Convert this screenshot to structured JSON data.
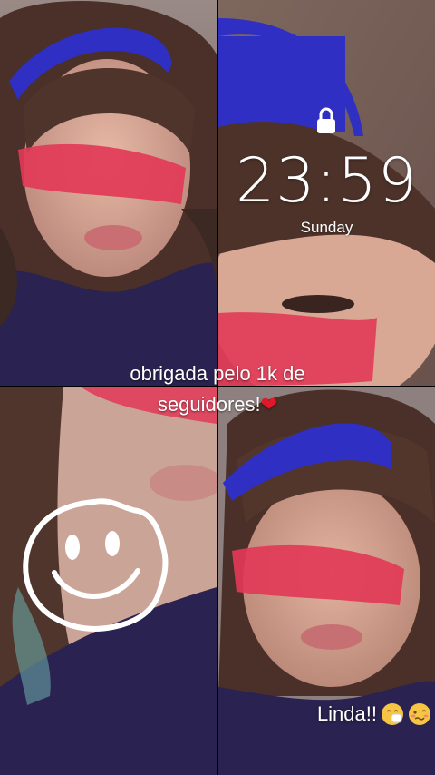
{
  "lockscreen": {
    "time": "23:59",
    "day": "Sunday",
    "lock_icon": "lock-icon"
  },
  "caption": {
    "line1": "obrigada pelo 1k de",
    "line2": "seguidores!",
    "heart": "❤"
  },
  "comment": {
    "text": "Linda!!",
    "emojis": [
      "sneezing-face-icon",
      "woozy-face-icon"
    ]
  },
  "doodle": "smiley-face-icon",
  "colors": {
    "headband": "#2f2fc4",
    "face_paint": "#e23a57",
    "hoodie": "#2a2250",
    "heart": "#e0182a"
  }
}
